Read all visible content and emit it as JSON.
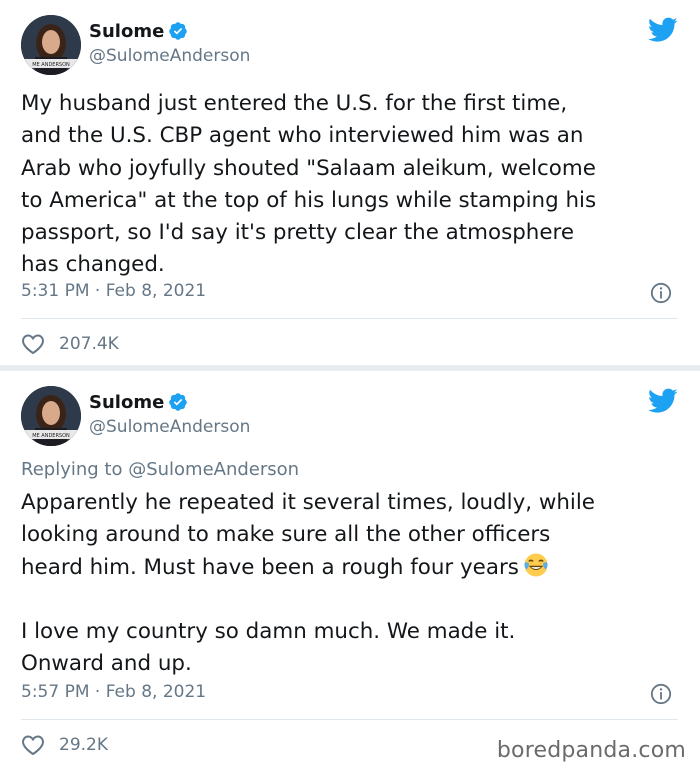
{
  "tweets": [
    {
      "display_name": "Sulome",
      "handle": "@SulomeAnderson",
      "avatar_caption": "ME ANDERSON",
      "text": "My husband just entered the U.S. for the first time,\nand the U.S. CBP agent who interviewed him was an\nArab who joyfully shouted \"Salaam aleikum, welcome\nto America\" at the top of his lungs while stamping his\npassport, so I'd say it's pretty clear the atmosphere\nhas changed.",
      "timestamp": "5:31 PM · Feb 8, 2021",
      "likes": "207.4K"
    },
    {
      "display_name": "Sulome",
      "handle": "@SulomeAnderson",
      "avatar_caption": "ME ANDERSON",
      "reply_prefix": "Replying to ",
      "reply_to": "@SulomeAnderson",
      "text_part1": "Apparently he repeated it several times, loudly, while\nlooking around to make sure all the other officers\nheard him. Must have been a rough four years",
      "emoji": "face-with-tears-of-joy",
      "text_part2": "\n\nI love my country so damn much. We made it.\nOnward and up.",
      "timestamp": "5:57 PM · Feb 8, 2021",
      "likes": "29.2K"
    }
  ],
  "watermark": "boredpanda.com",
  "colors": {
    "verified_blue": "#1da1f2",
    "secondary_text": "#657786",
    "background_gap": "#e6ecf0"
  }
}
